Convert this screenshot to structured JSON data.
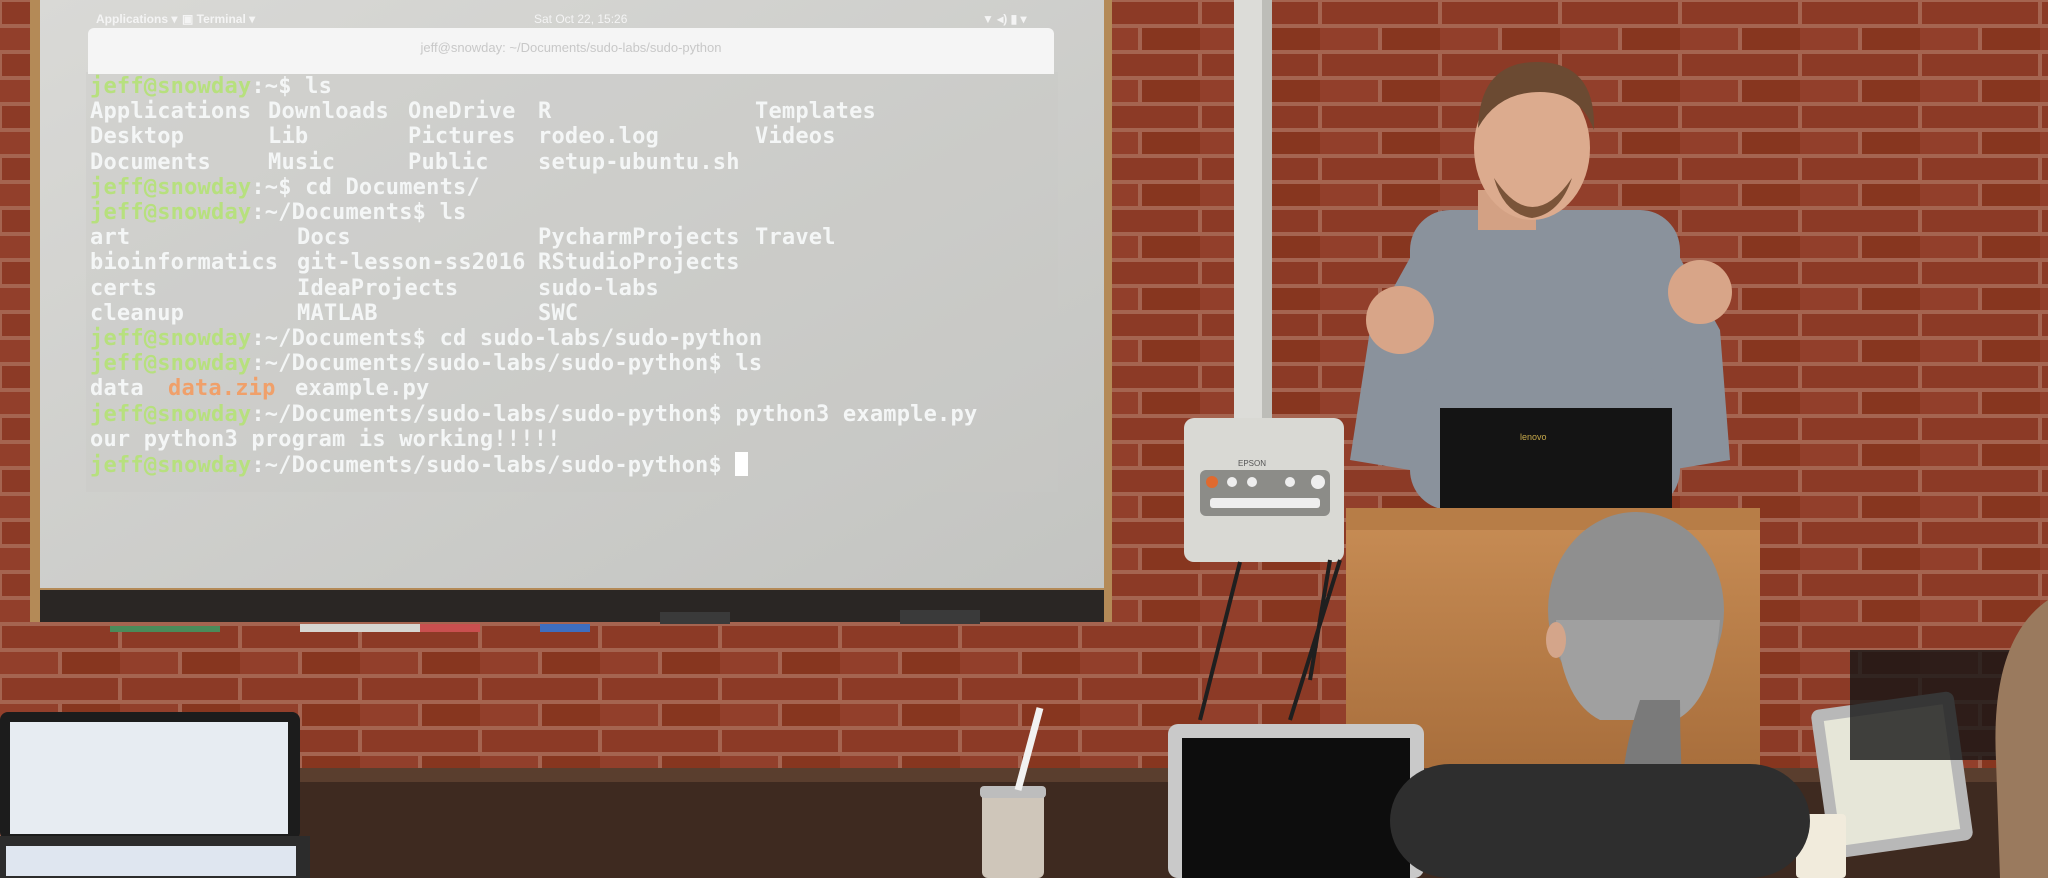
{
  "topbar": {
    "applications": "Applications ▾",
    "terminal": "▣ Terminal ▾",
    "clock": "Sat Oct 22, 15:26",
    "status_icons": "▼ ◂) ▮ ▾"
  },
  "window": {
    "title": "jeff@snowday: ~/Documents/sudo-labs/sudo-python"
  },
  "terminal": {
    "lines": [
      {
        "prompt": "jeff@snowday",
        "path": ":~$ ",
        "cmd": "ls"
      },
      {
        "cols": [
          "Applications",
          "Downloads",
          "OneDrive",
          "R",
          "Templates"
        ]
      },
      {
        "cols": [
          "Desktop",
          "Lib",
          "Pictures",
          "rodeo.log",
          "Videos"
        ]
      },
      {
        "cols": [
          "Documents",
          "Music",
          "Public",
          "setup-ubuntu.sh",
          ""
        ]
      },
      {
        "prompt": "jeff@snowday",
        "path": ":~$ ",
        "cmd": "cd Documents/"
      },
      {
        "prompt": "jeff@snowday",
        "path": ":~/Documents$ ",
        "cmd": "ls"
      },
      {
        "cols2": [
          "art",
          "Docs",
          "PycharmProjects",
          "Travel"
        ]
      },
      {
        "cols2": [
          "bioinformatics",
          "git-lesson-ss2016",
          "RStudioProjects",
          ""
        ]
      },
      {
        "cols2": [
          "certs",
          "IdeaProjects",
          "sudo-labs",
          ""
        ]
      },
      {
        "cols2": [
          "cleanup",
          "MATLAB",
          "SWC",
          ""
        ]
      },
      {
        "prompt": "jeff@snowday",
        "path": ":~/Documents$ ",
        "cmd": "cd sudo-labs/sudo-python"
      },
      {
        "prompt": "jeff@snowday",
        "path": ":~/Documents/sudo-labs/sudo-python$ ",
        "cmd": "ls"
      },
      {
        "files": [
          "data",
          "data.zip",
          "example.py"
        ]
      },
      {
        "prompt": "jeff@snowday",
        "path": ":~/Documents/sudo-labs/sudo-python$ ",
        "cmd": "python3 example.py"
      },
      {
        "output": "our python3 program is working!!!!!"
      },
      {
        "prompt": "jeff@snowday",
        "path": ":~/Documents/sudo-labs/sudo-python$ ",
        "cmd": ""
      }
    ]
  },
  "projector_brand": "EPSON",
  "laptop_brand": "lenovo",
  "colors": {
    "brick": "#8c3a26",
    "mortar": "#a86a55",
    "screen": "#cfcfcc",
    "prompt": "#b7e07e",
    "text": "#f4f6f6",
    "archive": "#f0a06a"
  }
}
